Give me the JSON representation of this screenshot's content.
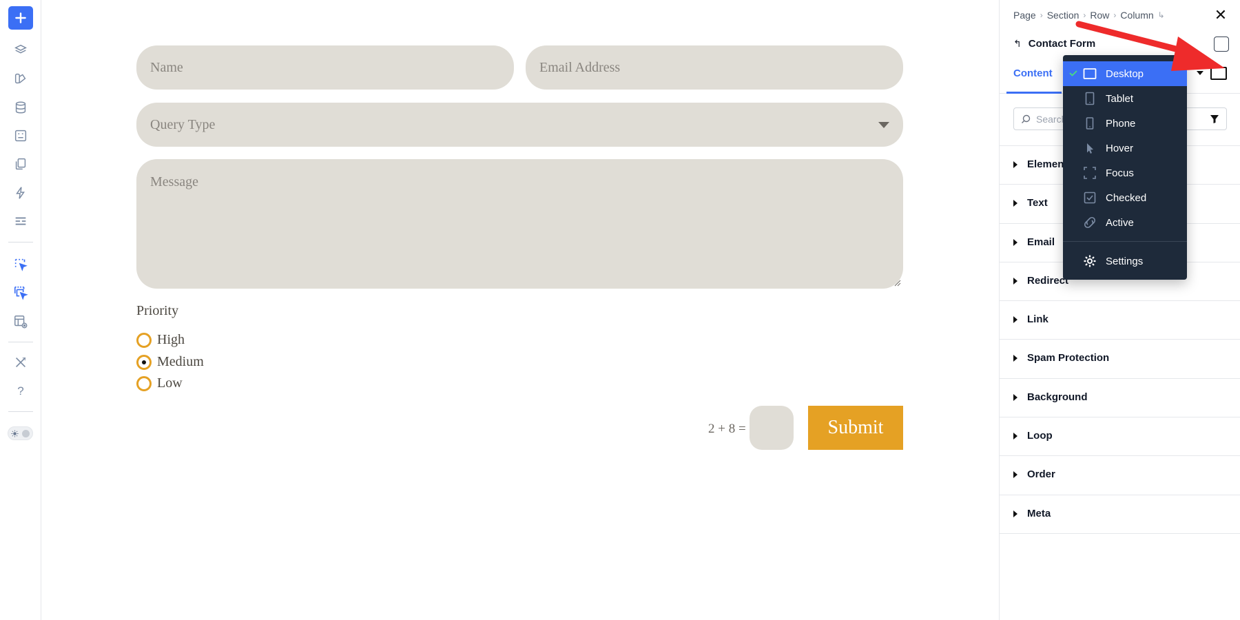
{
  "toolbar": {
    "items": [
      "add-icon",
      "layers-icon",
      "theme-icon",
      "database-icon",
      "form-icon",
      "pages-icon",
      "lightning-icon",
      "layout-icon",
      "cursor-select-icon",
      "cursor-multi-icon",
      "template-preview-icon",
      "tools-icon",
      "help-icon"
    ],
    "help_label": "?"
  },
  "form": {
    "name_placeholder": "Name",
    "email_placeholder": "Email Address",
    "query_placeholder": "Query Type",
    "message_placeholder": "Message",
    "priority_label": "Priority",
    "radios": [
      {
        "label": "High",
        "checked": false
      },
      {
        "label": "Medium",
        "checked": true
      },
      {
        "label": "Low",
        "checked": false
      }
    ],
    "captcha_question": "2 + 8 =",
    "submit_label": "Submit",
    "accent_color": "#e5a124",
    "field_color": "#e0ddd6"
  },
  "panel": {
    "breadcrumbs": [
      "Page",
      "Section",
      "Row",
      "Column"
    ],
    "title": "Contact Form",
    "tab_content": "Content",
    "search_placeholder": "Search",
    "groups": [
      "Elements",
      "Text",
      "Email",
      "Redirect",
      "Link",
      "Spam Protection",
      "Background",
      "Loop",
      "Order",
      "Meta"
    ]
  },
  "dropdown": {
    "items": [
      {
        "label": "Desktop",
        "icon": "desktop-icon",
        "active": true
      },
      {
        "label": "Tablet",
        "icon": "tablet-icon",
        "active": false
      },
      {
        "label": "Phone",
        "icon": "phone-icon",
        "active": false
      },
      {
        "label": "Hover",
        "icon": "pointer-icon",
        "active": false
      },
      {
        "label": "Focus",
        "icon": "focus-icon",
        "active": false
      },
      {
        "label": "Checked",
        "icon": "checkbox-icon",
        "active": false
      },
      {
        "label": "Active",
        "icon": "active-icon",
        "active": false
      }
    ],
    "settings_label": "Settings",
    "active_color": "#3b6ff5"
  }
}
